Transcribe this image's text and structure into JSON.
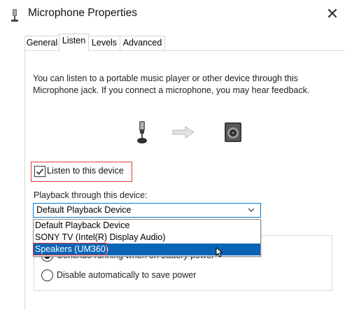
{
  "window": {
    "title": "Microphone Properties",
    "close_glyph": "✕"
  },
  "tabs": [
    {
      "label": "General",
      "active": false
    },
    {
      "label": "Listen",
      "active": true
    },
    {
      "label": "Levels",
      "active": false
    },
    {
      "label": "Advanced",
      "active": false
    }
  ],
  "listen": {
    "description": "You can listen to a portable music player or other device through this Microphone jack.  If you connect a microphone, you may hear feedback.",
    "checkbox_label": "Listen to this device",
    "checkbox_checked": true,
    "playback_label": "Playback through this device:",
    "selected_device": "Default Playback Device",
    "options": [
      "Default Playback Device",
      "SONY TV (Intel(R) Display Audio)",
      "Speakers (UM360)"
    ]
  },
  "power": {
    "option1": "Continue running when on battery power",
    "option2": "Disable automatically to save power",
    "selected": 1
  },
  "icons": {
    "window": "microphone-icon",
    "source": "microphone-icon",
    "arrow": "arrow-right-icon",
    "target": "speaker-icon",
    "dropdown": "chevron-down-icon",
    "pointer": "mouse-cursor-icon"
  },
  "colors": {
    "accent": "#0078d7",
    "selection": "#0a64b6",
    "highlight": "#e0393e"
  }
}
